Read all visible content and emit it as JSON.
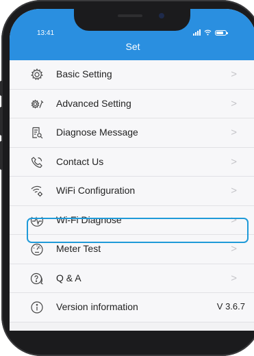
{
  "status_bar": {
    "time": "13:41",
    "icons": [
      "cellular-signal-icon",
      "wifi-icon",
      "battery-icon"
    ]
  },
  "header": {
    "title": "Set",
    "color": "#2a8fe0"
  },
  "menu": {
    "items": [
      {
        "label": "Basic Setting",
        "icon": "gear-icon",
        "trailing": ">"
      },
      {
        "label": "Advanced Setting",
        "icon": "gear-wrench-icon",
        "trailing": ">"
      },
      {
        "label": "Diagnose Message",
        "icon": "document-search-icon",
        "trailing": ">"
      },
      {
        "label": "Contact Us",
        "icon": "phone-icon",
        "trailing": ">"
      },
      {
        "label": "WiFi Configuration",
        "icon": "wifi-settings-icon",
        "trailing": ">"
      },
      {
        "label": "Wi-Fi Diagnose",
        "icon": "pulse-icon",
        "trailing": ">"
      },
      {
        "label": "Meter Test",
        "icon": "gauge-icon",
        "trailing": ">"
      },
      {
        "label": "Q & A",
        "icon": "question-chat-icon",
        "trailing": ">",
        "highlighted": true
      },
      {
        "label": "Version information",
        "icon": "info-icon",
        "value": "V 3.6.7"
      }
    ]
  },
  "highlight_color": "#1f9ad8"
}
